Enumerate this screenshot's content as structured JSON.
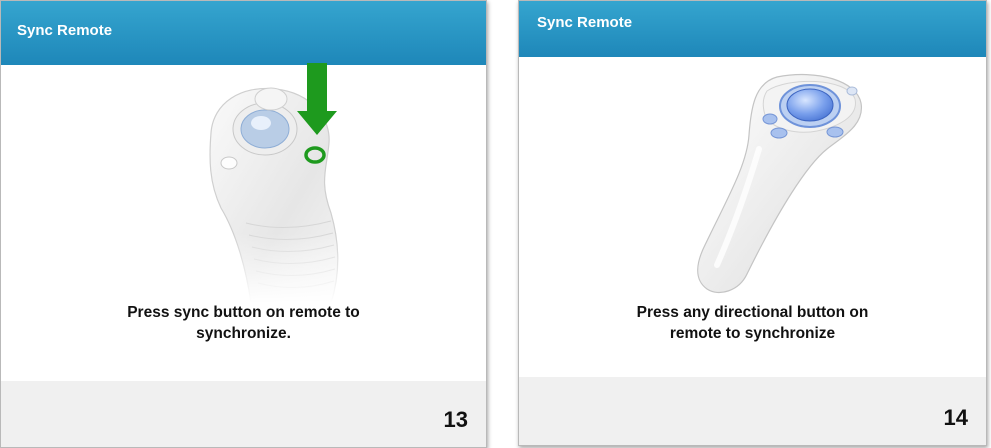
{
  "panels": [
    {
      "title": "Sync Remote",
      "instruction_line1": "Press sync button on remote to",
      "instruction_line2": "synchronize.",
      "page_number": "13",
      "icon": "remote-sync-button-illustration"
    },
    {
      "title": "Sync Remote",
      "instruction_line1": "Press any directional button on",
      "instruction_line2": "remote to synchronize",
      "page_number": "14",
      "icon": "remote-directional-pad-illustration"
    }
  ],
  "colors": {
    "header_blue": "#2596c6",
    "highlight_green": "#1e9a1e",
    "pad_blue": "#5a88e0",
    "footer_gray": "#f0f0f0"
  }
}
